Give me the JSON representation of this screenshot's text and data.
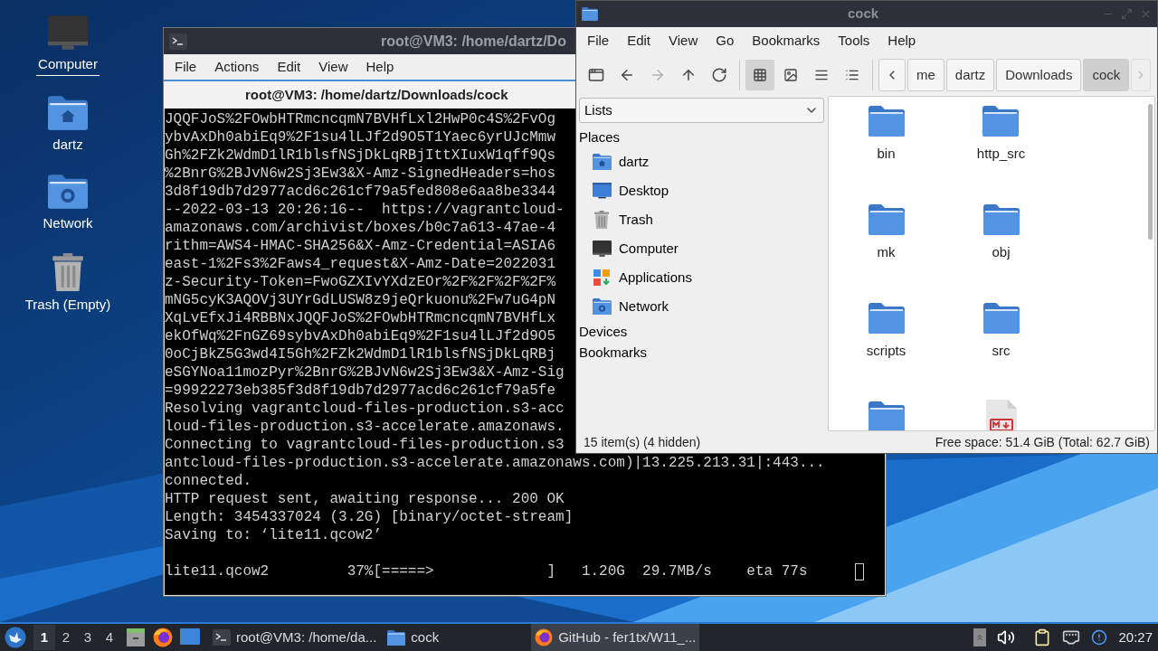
{
  "desktop": {
    "icons": [
      {
        "label": "Computer",
        "kind": "computer",
        "focused": true
      },
      {
        "label": "dartz",
        "kind": "home",
        "focused": false
      },
      {
        "label": "Network",
        "kind": "network",
        "focused": false
      },
      {
        "label": "Trash (Empty)",
        "kind": "trash",
        "focused": false
      }
    ]
  },
  "terminal": {
    "title": "root@VM3: /home/dartz/Do",
    "menu": [
      "File",
      "Actions",
      "Edit",
      "View",
      "Help"
    ],
    "tab": "root@VM3: /home/dartz/Downloads/cock",
    "lines": [
      "JQQFJoS%2FOwbHTRmcncqmN7BVHfLxl2HwP0c4S%2FvOg",
      "ybvAxDh0abiEq9%2F1su4lLJf2d9O5T1Yaec6yrUJcMmw",
      "Gh%2FZk2WdmD1lR1blsfNSjDkLqRBjIttXIuxW1qff9Qs",
      "%2BnrG%2BJvN6w2Sj3Ew3&X-Amz-SignedHeaders=hos",
      "3d8f19db7d2977acd6c261cf79a5fed808e6aa8be3344",
      "--2022-03-13 20:26:16--  https://vagrantcloud-",
      "amazonaws.com/archivist/boxes/b0c7a613-47ae-4",
      "rithm=AWS4-HMAC-SHA256&X-Amz-Credential=ASIA6",
      "east-1%2Fs3%2Faws4_request&X-Amz-Date=2022031",
      "z-Security-Token=FwoGZXIvYXdzEOr%2F%2F%2F%2F%",
      "mNG5cyK3AQOVj3UYrGdLUSW8z9jeQrkuonu%2Fw7uG4pN",
      "XqLvEfxJi4RBBNxJQQFJoS%2FOwbHTRmcncqmN7BVHfLx",
      "ekOfWq%2FnGZ69sybvAxDh0abiEq9%2F1su4lLJf2d9O5",
      "0oCjBkZ5G3wd4I5Gh%2FZk2WdmD1lR1blsfNSjDkLqRBj",
      "eSGYNoa11mozPyr%2BnrG%2BJvN6w2Sj3Ew3&X-Amz-Sig",
      "=99922273eb385f3d8f19db7d2977acd6c261cf79a5fe",
      "Resolving vagrantcloud-files-production.s3-acc",
      "loud-files-production.s3-accelerate.amazonaws.",
      "Connecting to vagrantcloud-files-production.s3",
      "antcloud-files-production.s3-accelerate.amazonaws.com)|13.225.213.31|:443...",
      "connected.",
      "HTTP request sent, awaiting response... 200 OK",
      "Length: 3454337024 (3.2G) [binary/octet-stream]",
      "Saving to: ‘lite11.qcow2’"
    ],
    "progress": "lite11.qcow2         37%[=====>             ]   1.20G  29.7MB/s    eta 77s"
  },
  "file_manager": {
    "title": "cock",
    "menu": [
      "File",
      "Edit",
      "View",
      "Go",
      "Bookmarks",
      "Tools",
      "Help"
    ],
    "nav": [
      {
        "kind": "new-tab",
        "disabled": false
      },
      {
        "kind": "back",
        "disabled": false
      },
      {
        "kind": "forward",
        "disabled": true
      },
      {
        "kind": "up",
        "disabled": false
      },
      {
        "kind": "reload",
        "disabled": false
      }
    ],
    "views": [
      {
        "kind": "icons",
        "selected": true
      },
      {
        "kind": "thumbnails",
        "selected": false
      },
      {
        "kind": "compact",
        "selected": false
      },
      {
        "kind": "list",
        "selected": false
      }
    ],
    "path": {
      "crumbs": [
        {
          "label": "me",
          "selected": false
        },
        {
          "label": "dartz",
          "selected": false
        },
        {
          "label": "Downloads",
          "selected": false
        },
        {
          "label": "cock",
          "selected": true
        }
      ],
      "next_disabled": true
    },
    "side_mode": "Lists",
    "places_heading": "Places",
    "places": [
      {
        "label": "dartz",
        "kind": "home"
      },
      {
        "label": "Desktop",
        "kind": "desktop"
      },
      {
        "label": "Trash",
        "kind": "trash"
      },
      {
        "label": "Computer",
        "kind": "computer"
      },
      {
        "label": "Applications",
        "kind": "applications"
      },
      {
        "label": "Network",
        "kind": "network"
      }
    ],
    "sections": [
      "Devices",
      "Bookmarks"
    ],
    "files": [
      {
        "name": "bin",
        "kind": "folder"
      },
      {
        "name": "http_src",
        "kind": "folder"
      },
      {
        "name": "mk",
        "kind": "folder"
      },
      {
        "name": "obj",
        "kind": "folder"
      },
      {
        "name": "scripts",
        "kind": "folder"
      },
      {
        "name": "src",
        "kind": "folder"
      },
      {
        "kind": "folder"
      },
      {
        "kind": "markdown"
      }
    ],
    "status_left": "15 item(s) (4 hidden)",
    "status_right": "Free space: 51.4 GiB (Total: 62.7 GiB)"
  },
  "taskbar": {
    "workspaces": [
      {
        "label": "1",
        "selected": true
      },
      {
        "label": "2",
        "selected": false
      },
      {
        "label": "3",
        "selected": false
      },
      {
        "label": "4",
        "selected": false
      }
    ],
    "tasks": [
      {
        "label": "root@VM3: /home/da...",
        "kind": "terminal",
        "selected": false
      },
      {
        "label": "cock",
        "kind": "folder",
        "selected": false
      },
      {
        "label": "GitHub - fer1tx/W11_...",
        "kind": "browser",
        "selected": true
      }
    ],
    "clock": "20:27"
  }
}
